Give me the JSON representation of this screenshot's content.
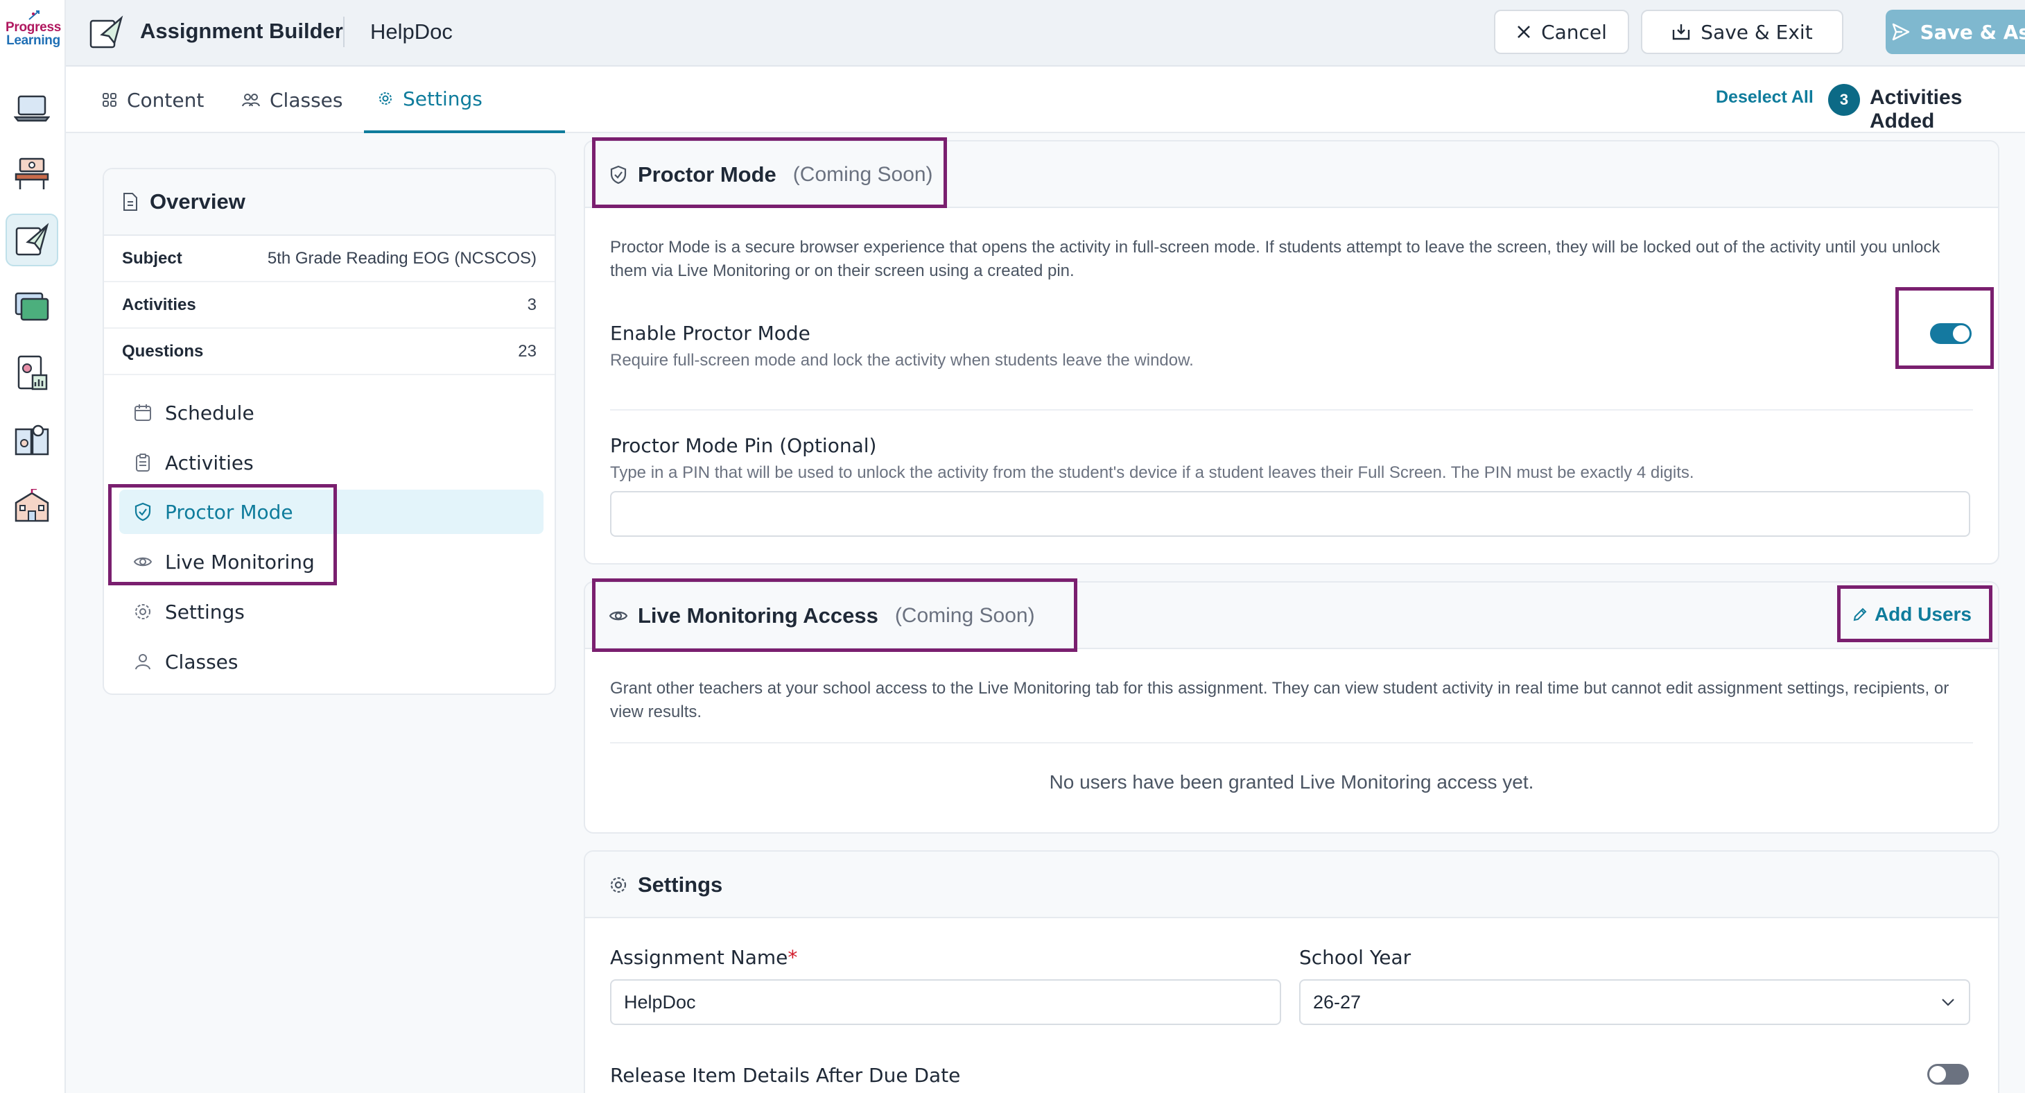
{
  "brand": {
    "logo_line1": "Progress",
    "logo_line2": "Learning"
  },
  "header": {
    "title": "Assignment Builder",
    "assignment_name": "HelpDoc",
    "cancel_label": "Cancel",
    "save_exit_label": "Save & Exit",
    "save_assign_label": "Save & Assign"
  },
  "rail": {
    "icons": [
      "laptop-icon",
      "classroom-desk-icon",
      "assignment-paper-plane-icon",
      "folders-icon",
      "report-chart-icon",
      "book-people-icon",
      "school-building-icon"
    ],
    "active_index": 2
  },
  "tabs": [
    {
      "label": "Content",
      "icon": "grid-icon"
    },
    {
      "label": "Classes",
      "icon": "people-icon"
    },
    {
      "label": "Settings",
      "icon": "gear-icon",
      "active": true
    }
  ],
  "toolbar": {
    "deselect_all": "Deselect All",
    "activities_count": "3",
    "activities_added": "Activities Added"
  },
  "overview": {
    "title": "Overview",
    "rows": [
      {
        "key": "Subject",
        "value": "5th Grade Reading EOG (NCSCOS)"
      },
      {
        "key": "Activities",
        "value": "3"
      },
      {
        "key": "Questions",
        "value": "23"
      }
    ],
    "nav": [
      {
        "label": "Schedule",
        "icon": "calendar-icon"
      },
      {
        "label": "Activities",
        "icon": "clipboard-icon"
      },
      {
        "label": "Proctor Mode",
        "icon": "shield-check-icon",
        "active": true
      },
      {
        "label": "Live Monitoring",
        "icon": "eye-icon"
      },
      {
        "label": "Settings",
        "icon": "gear-icon"
      },
      {
        "label": "Classes",
        "icon": "users-icon"
      }
    ]
  },
  "proctor": {
    "title": "Proctor Mode",
    "coming_soon": "(Coming Soon)",
    "description": "Proctor Mode is a secure browser experience that opens the activity in full-screen mode. If students attempt to leave the screen, they will be locked out of the activity until you unlock them via Live Monitoring or on their screen using a created pin.",
    "enable_label": "Enable Proctor Mode",
    "enable_sub": "Require full-screen mode and lock the activity when students leave the window.",
    "enabled": true,
    "pin_label": "Proctor Mode Pin (Optional)",
    "pin_sub": "Type in a PIN that will be used to unlock the activity from the student's device if a student leaves their Full Screen. The PIN must be exactly 4 digits.",
    "pin_value": ""
  },
  "live": {
    "title": "Live Monitoring Access",
    "coming_soon": "(Coming Soon)",
    "add_users": "Add Users",
    "description": "Grant other teachers at your school access to the Live Monitoring tab for this assignment. They can view student activity in real time but cannot edit assignment settings, recipients, or view results.",
    "empty": "No users have been granted Live Monitoring access yet."
  },
  "settings": {
    "title": "Settings",
    "name_label": "Assignment Name",
    "required_mark": "*",
    "name_value": "HelpDoc",
    "year_label": "School Year",
    "year_value": "26-27",
    "release_label": "Release Item Details After Due Date",
    "release_enabled": false
  },
  "colors": {
    "accent": "#0f7c9c",
    "highlight": "#7a1f6f",
    "primary_disabled": "#7fb8cf"
  }
}
